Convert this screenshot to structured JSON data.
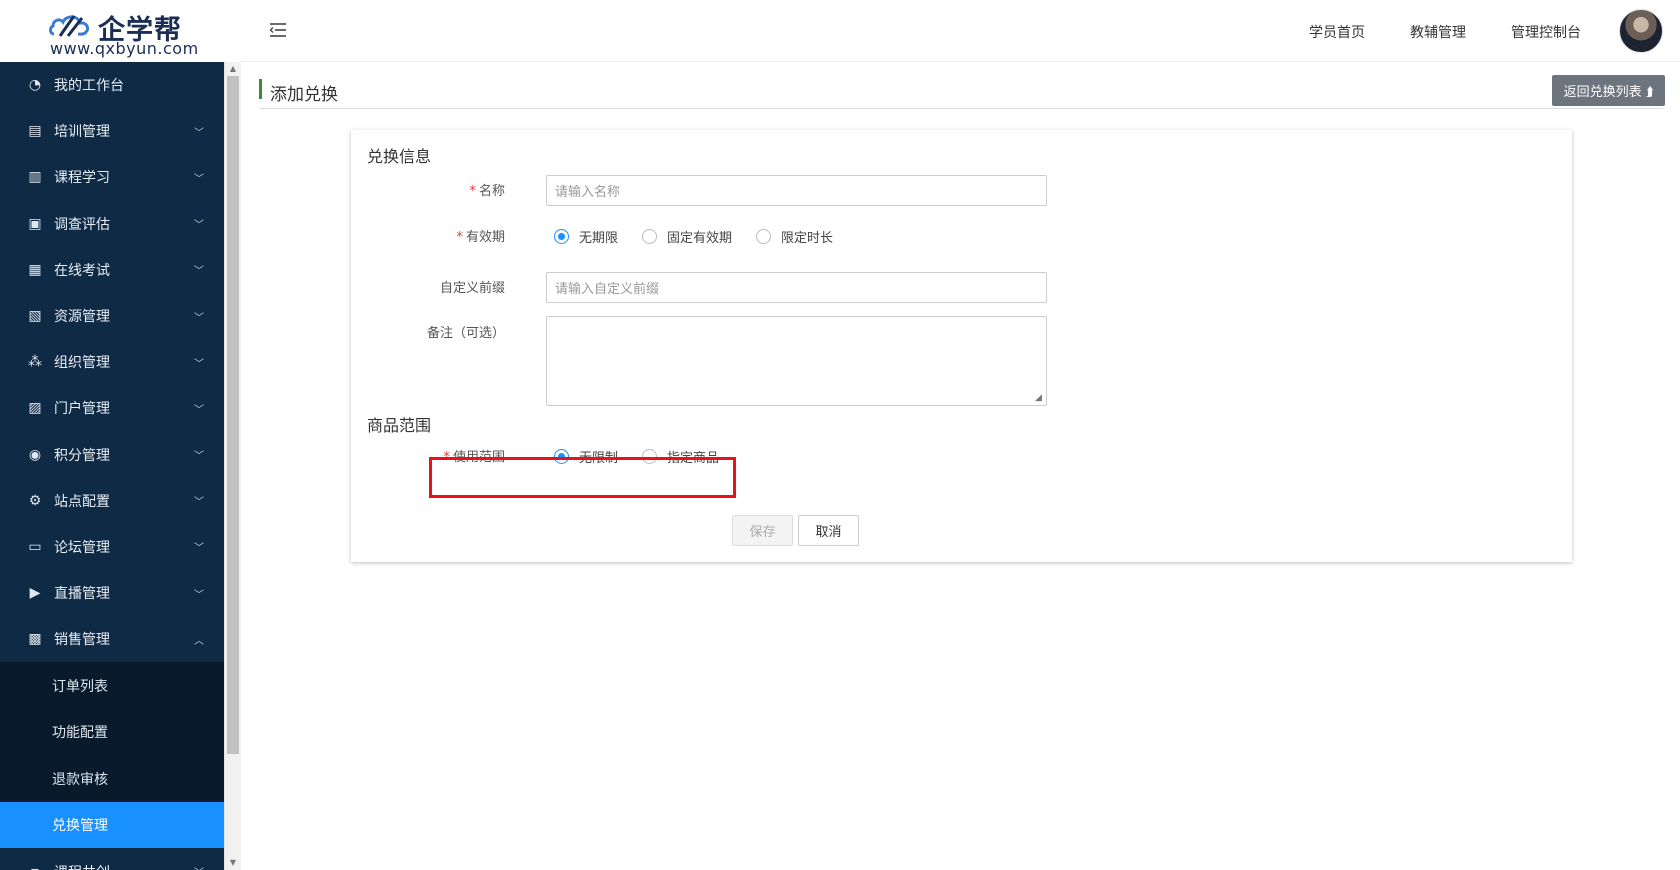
{
  "logo": {
    "brand": "企学帮",
    "url": "www.qxbyun.com"
  },
  "sidebar": {
    "items": [
      {
        "label": "我的工作台",
        "icon": "dashboard-icon",
        "chevron": false
      },
      {
        "label": "培训管理",
        "icon": "training-icon",
        "chevron": true
      },
      {
        "label": "课程学习",
        "icon": "course-icon",
        "chevron": true
      },
      {
        "label": "调查评估",
        "icon": "survey-icon",
        "chevron": true
      },
      {
        "label": "在线考试",
        "icon": "exam-icon",
        "chevron": true
      },
      {
        "label": "资源管理",
        "icon": "resource-icon",
        "chevron": true
      },
      {
        "label": "组织管理",
        "icon": "org-icon",
        "chevron": true
      },
      {
        "label": "门户管理",
        "icon": "portal-icon",
        "chevron": true
      },
      {
        "label": "积分管理",
        "icon": "points-icon",
        "chevron": true
      },
      {
        "label": "站点配置",
        "icon": "site-config-icon",
        "chevron": true
      },
      {
        "label": "论坛管理",
        "icon": "forum-icon",
        "chevron": true
      },
      {
        "label": "直播管理",
        "icon": "live-icon",
        "chevron": true
      },
      {
        "label": "销售管理",
        "icon": "sales-icon",
        "chevron": true,
        "open": true
      }
    ],
    "sales_sub": [
      "订单列表",
      "功能配置",
      "退款审核",
      "兑换管理"
    ],
    "active_sub": "兑换管理",
    "next_item": "课程共创"
  },
  "header": {
    "nav": [
      "学员首页",
      "教辅管理",
      "管理控制台"
    ]
  },
  "page": {
    "title": "添加兑换",
    "back_button": "返回兑换列表 ⮭"
  },
  "form": {
    "section1_title": "兑换信息",
    "name_label": "名称",
    "name_placeholder": "请输入名称",
    "validity_label": "有效期",
    "validity_options": [
      "无期限",
      "固定有效期",
      "限定时长"
    ],
    "validity_selected": "无期限",
    "prefix_label": "自定义前缀",
    "prefix_placeholder": "请输入自定义前缀",
    "remark_label": "备注（可选）",
    "section2_title": "商品范围",
    "scope_label": "使用范围",
    "scope_options": [
      "无限制",
      "指定商品"
    ],
    "scope_selected": "无限制",
    "save_label": "保存",
    "cancel_label": "取消",
    "required_mark": "*"
  },
  "colors": {
    "sidebar_bg": "#0f2a44",
    "active": "#1890ff",
    "highlight": "#e8131a",
    "required": "#e33333"
  }
}
